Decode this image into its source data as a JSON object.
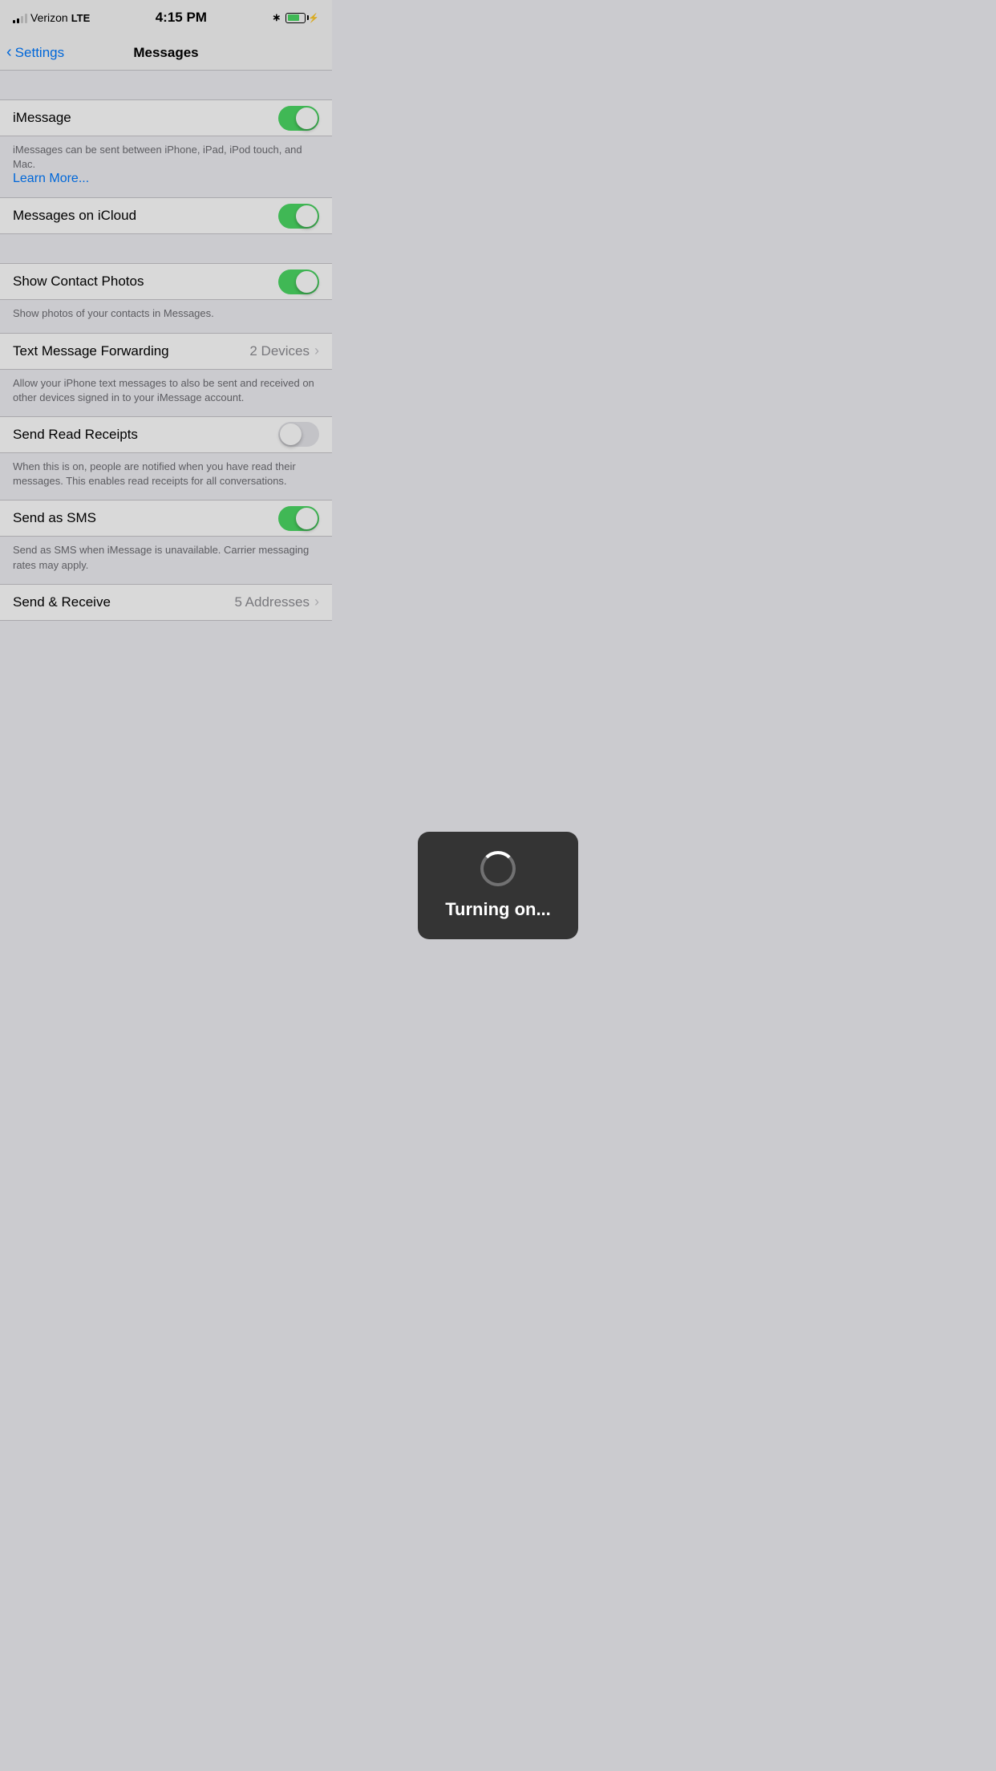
{
  "statusBar": {
    "carrier": "Verizon",
    "networkType": "LTE",
    "time": "4:15 PM",
    "bluetoothActive": true
  },
  "navBar": {
    "backLabel": "Settings",
    "title": "Messages"
  },
  "settings": {
    "iMessage": {
      "label": "iMessage",
      "toggleOn": true,
      "description": "iMessages can be sent between iPhone, iPad, iPod touch, and Mac.",
      "learnMore": "Learn More..."
    },
    "messagesOnICloud": {
      "label": "Messages on iCloud",
      "toggleOn": true
    },
    "showContactPhotos": {
      "label": "Show Contact Photos",
      "toggleOn": true,
      "description": "Show photos of your contacts in Messages."
    },
    "textMessageForwarding": {
      "label": "Text Message Forwarding",
      "value": "2 Devices",
      "description": "Allow your iPhone text messages to also be sent and received on other devices signed in to your iMessage account."
    },
    "sendReadReceipts": {
      "label": "Send Read Receipts",
      "toggleOn": false,
      "description": "When this is on, people are notified when you have read their messages. This enables read receipts for all conversations."
    },
    "sendAsSMS": {
      "label": "Send as SMS",
      "toggleOn": true,
      "description": "Send as SMS when iMessage is unavailable. Carrier messaging rates may apply."
    },
    "sendReceive": {
      "label": "Send & Receive",
      "value": "5 Addresses"
    }
  },
  "overlay": {
    "text": "Turning on..."
  }
}
